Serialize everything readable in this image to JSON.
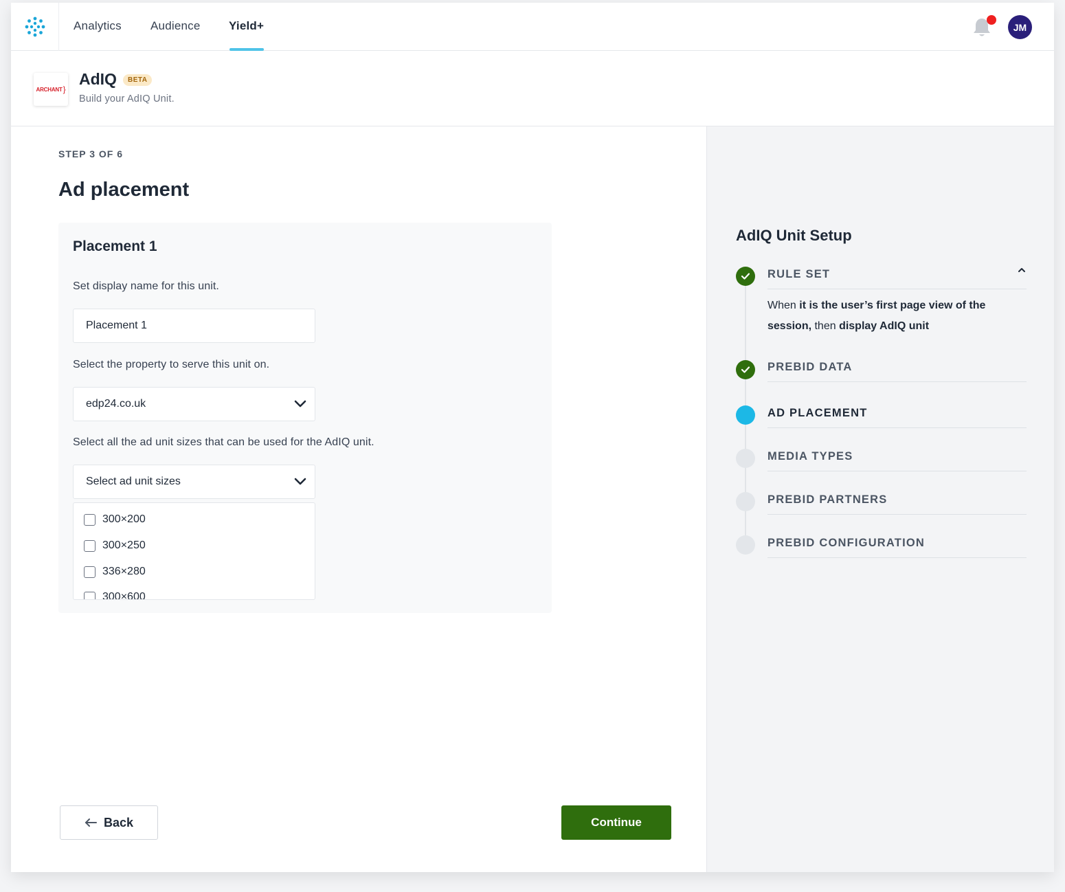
{
  "nav": {
    "logo_icon": "dots-cluster-icon",
    "links": [
      {
        "label": "Analytics"
      },
      {
        "label": "Audience"
      },
      {
        "label": "Yield+",
        "active": true
      }
    ],
    "avatar_initials": "JM",
    "accent_color": "#4fc3e8"
  },
  "header": {
    "brand_logo_text": "ARCHANT",
    "title": "AdIQ",
    "badge": "BETA",
    "subtitle": "Build your AdIQ Unit."
  },
  "main": {
    "step_text": "STEP 3 OF 6",
    "title": "Ad placement",
    "card": {
      "title": "Placement 1",
      "name_label": "Set display name for this unit.",
      "name_value": "Placement 1",
      "property_label": "Select the property to serve this unit on.",
      "property_value": "edp24.co.uk",
      "sizes_label": "Select all the ad unit sizes that can be used for the AdIQ unit.",
      "sizes_placeholder": "Select ad unit sizes",
      "sizes": [
        {
          "label": "300×200",
          "checked": false
        },
        {
          "label": "300×250",
          "checked": false
        },
        {
          "label": "336×280",
          "checked": false
        },
        {
          "label": "300×600",
          "checked": false
        }
      ]
    },
    "back_label": "Back",
    "continue_label": "Continue",
    "continue_color": "#2f6e0d"
  },
  "sidebar": {
    "title": "AdIQ Unit Setup",
    "steps": [
      {
        "label": "RULE SET",
        "status": "done"
      },
      {
        "label": "PREBID DATA",
        "status": "done"
      },
      {
        "label": "AD PLACEMENT",
        "status": "current"
      },
      {
        "label": "MEDIA TYPES",
        "status": "todo"
      },
      {
        "label": "PREBID PARTNERS",
        "status": "todo"
      },
      {
        "label": "PREBID CONFIGURATION",
        "status": "todo"
      }
    ],
    "rule_desc": {
      "p1": "When ",
      "p2": "it is the user’s first page view of the session,",
      "p3": " then ",
      "p4": "display AdIQ unit"
    },
    "status_colors": {
      "done": "#2f6e0d",
      "current": "#1cb8e6",
      "todo": "#e3e6ea"
    }
  }
}
